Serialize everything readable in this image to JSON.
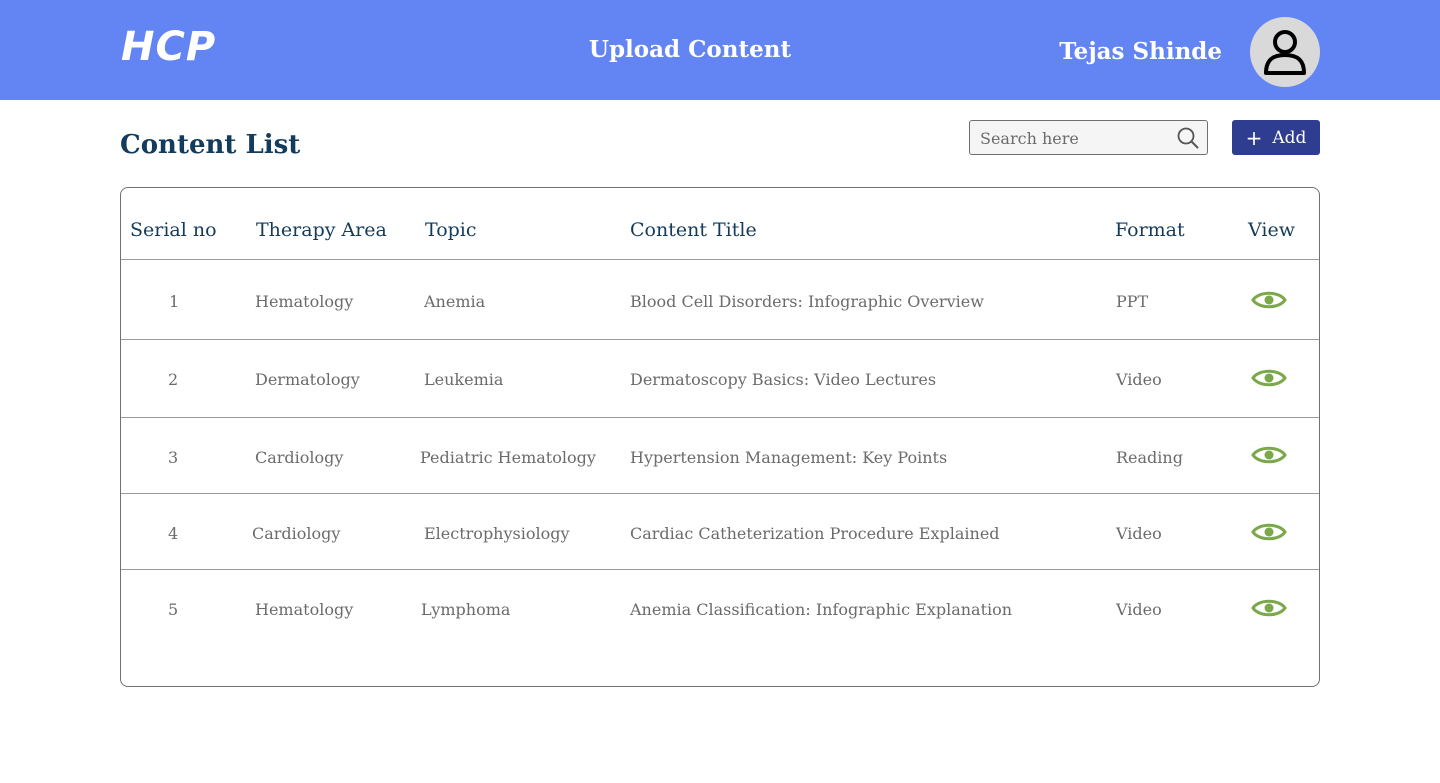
{
  "header": {
    "logo": "HCP",
    "title": "Upload Content",
    "user_name": "Tejas Shinde",
    "avatar_icon": "user-icon"
  },
  "toolbar": {
    "page_title": "Content List",
    "search_placeholder": "Search here",
    "search_value": "",
    "add_label": "Add",
    "add_icon": "plus-icon"
  },
  "table": {
    "columns": [
      "Serial no",
      "Therapy Area",
      "Topic",
      "Content Title",
      "Format",
      "View"
    ],
    "rows": [
      {
        "serial": "1",
        "therapy_area": "Hematology",
        "topic": "Anemia",
        "title": "Blood Cell Disorders: Infographic Overview",
        "format": "PPT"
      },
      {
        "serial": "2",
        "therapy_area": "Dermatology",
        "topic": "Leukemia",
        "title": "Dermatoscopy Basics: Video Lectures",
        "format": "Video"
      },
      {
        "serial": "3",
        "therapy_area": "Cardiology",
        "topic": "Pediatric Hematology",
        "title": "Hypertension Management: Key Points",
        "format": "Reading"
      },
      {
        "serial": "4",
        "therapy_area": "Cardiology",
        "topic": "Electrophysiology",
        "title": "Cardiac Catheterization Procedure Explained",
        "format": "Video"
      },
      {
        "serial": "5",
        "therapy_area": "Hematology",
        "topic": "Lymphoma",
        "title": "Anemia Classification: Infographic Explanation",
        "format": "Video"
      }
    ],
    "view_icon": "eye-icon"
  },
  "colors": {
    "header_bg": "#6384f3",
    "primary_button": "#2e3d8f",
    "title_text": "#133b5c",
    "view_icon": "#7aa84b"
  }
}
